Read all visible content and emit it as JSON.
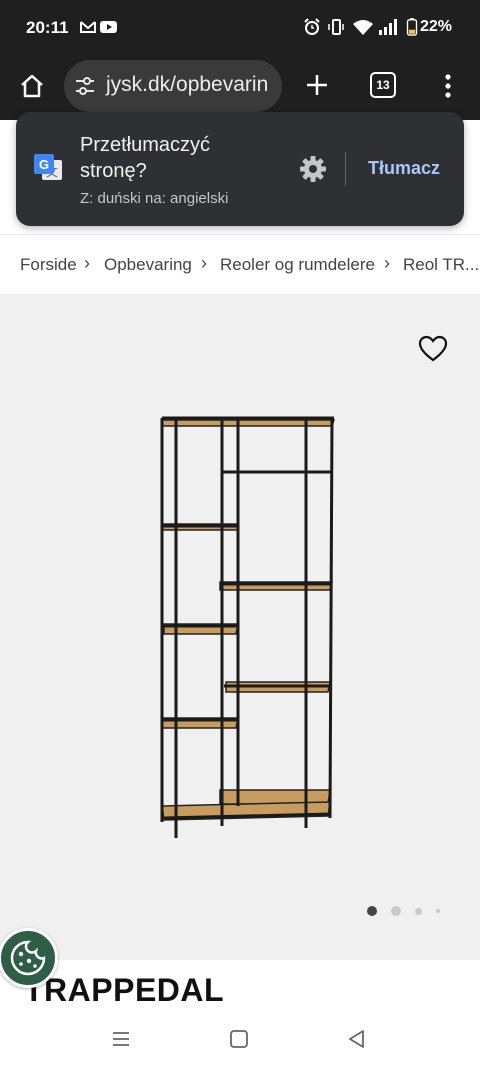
{
  "status_bar": {
    "time": "20:11",
    "battery": "22%",
    "icons": [
      "gmail-icon",
      "youtube-icon",
      "alarm-icon",
      "vibrate-icon",
      "wifi-icon",
      "signal-icon",
      "battery-icon"
    ]
  },
  "browser": {
    "url": "jysk.dk/opbevarin",
    "tab_count": "13",
    "icons": [
      "home-icon",
      "site-settings-icon",
      "new-tab-icon",
      "tab-switcher-icon",
      "more-menu-icon"
    ]
  },
  "translate_popup": {
    "title": "Przetłumaczyć stronę?",
    "subtitle": "Z: duński na: angielski",
    "action": "Tłumacz",
    "accent": "#a8c7fa"
  },
  "breadcrumb": [
    {
      "label": "Forside"
    },
    {
      "label": "Opbevaring"
    },
    {
      "label": "Reoler og rumdelere"
    },
    {
      "label": "Reol TR..."
    }
  ],
  "product": {
    "title": "TRAPPEDAL",
    "image_count": 4,
    "active_image": 1
  },
  "colors": {
    "cookie_button": "#2f5e47",
    "gallery_bg": "#f0f0f0"
  }
}
